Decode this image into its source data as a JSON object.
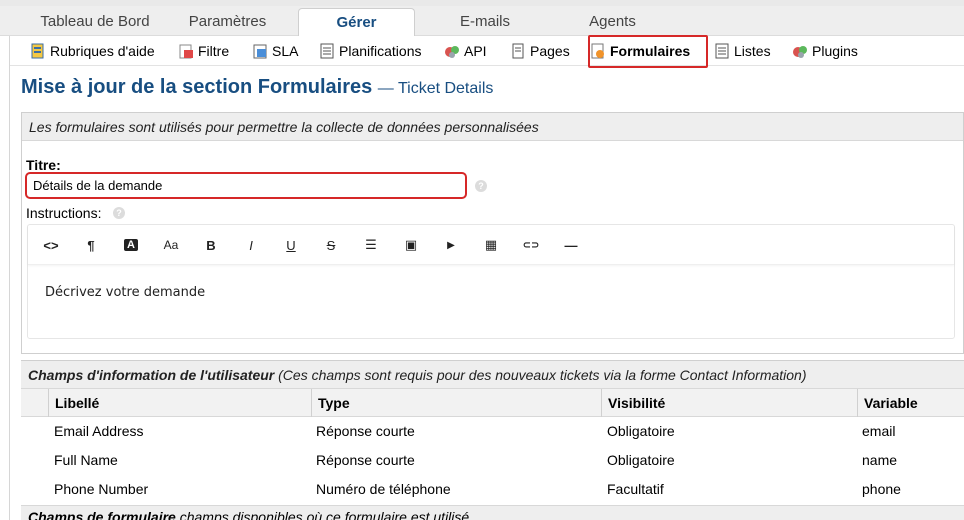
{
  "topnav": {
    "tabs": [
      {
        "label": "Tableau de Bord"
      },
      {
        "label": "Paramètres"
      },
      {
        "label": "Gérer"
      },
      {
        "label": "E-mails"
      },
      {
        "label": "Agents"
      }
    ]
  },
  "subnav": {
    "items": [
      {
        "label": "Rubriques d'aide",
        "icon": "help-topics-icon"
      },
      {
        "label": "Filtre",
        "icon": "filter-icon"
      },
      {
        "label": "SLA",
        "icon": "sla-icon"
      },
      {
        "label": "Planifications",
        "icon": "schedule-icon"
      },
      {
        "label": "API",
        "icon": "api-icon"
      },
      {
        "label": "Pages",
        "icon": "pages-icon"
      },
      {
        "label": "Formulaires",
        "icon": "forms-icon"
      },
      {
        "label": "Listes",
        "icon": "lists-icon"
      },
      {
        "label": "Plugins",
        "icon": "plugins-icon"
      }
    ]
  },
  "page": {
    "title": "Mise à jour de la section Formulaires",
    "subtitle": "— Ticket Details"
  },
  "form": {
    "description": "Les formulaires sont utilisés pour permettre la collecte de données personnalisées",
    "title_label": "Titre:",
    "title_value": "Détails de la demande",
    "instructions_label": "Instructions:",
    "instructions_text": "Décrivez votre demande",
    "help_glyph": "?"
  },
  "editor": {
    "toolbar": [
      {
        "icon": "code-view-icon",
        "glyph": "<>"
      },
      {
        "icon": "paragraph-icon",
        "glyph": "¶"
      },
      {
        "icon": "font-color-icon",
        "glyph": "A"
      },
      {
        "icon": "font-size-icon",
        "glyph": "Aa"
      },
      {
        "icon": "bold-icon",
        "glyph": "B"
      },
      {
        "icon": "italic-icon",
        "glyph": "I"
      },
      {
        "icon": "underline-icon",
        "glyph": "U"
      },
      {
        "icon": "strikethrough-icon",
        "glyph": "S"
      },
      {
        "icon": "bullet-list-icon",
        "glyph": "☰"
      },
      {
        "icon": "image-icon",
        "glyph": "▣"
      },
      {
        "icon": "video-icon",
        "glyph": "▶"
      },
      {
        "icon": "table-icon",
        "glyph": "▦"
      },
      {
        "icon": "link-icon",
        "glyph": "⊂⊃"
      },
      {
        "icon": "horizontal-rule-icon",
        "glyph": "—"
      }
    ]
  },
  "user_fields": {
    "heading_bold": "Champs d'information de l'utilisateur",
    "heading_rest": " (Ces champs sont requis pour des nouveaux tickets via la forme Contact Information)",
    "columns": [
      "Libellé",
      "Type",
      "Visibilité",
      "Variable"
    ],
    "rows": [
      [
        "Email Address",
        "Réponse courte",
        "Obligatoire",
        "email"
      ],
      [
        "Full Name",
        "Réponse courte",
        "Obligatoire",
        "name"
      ],
      [
        "Phone Number",
        "Numéro de téléphone",
        "Facultatif",
        "phone"
      ]
    ]
  },
  "form_fields": {
    "heading_bold": "Champs de formulaire",
    "heading_rest": " champs disponibles où ce formulaire est utilisé"
  },
  "colors": {
    "accent": "#184e81",
    "highlight": "#d62828"
  }
}
